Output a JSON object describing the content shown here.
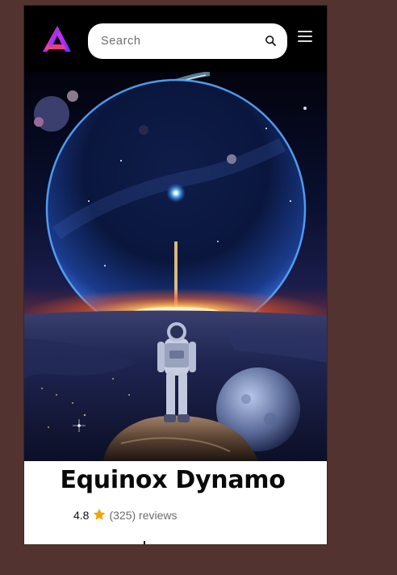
{
  "header": {
    "logo_icon": "a-letter-logo-icon",
    "search": {
      "placeholder": "Search",
      "value": "",
      "icon": "search-icon"
    },
    "menu_icon": "hamburger-menu-icon"
  },
  "hero": {
    "image": "astronaut-on-rock-facing-planet-rise-illustration"
  },
  "product": {
    "title": "Equinox Dynamo",
    "rating": "4.8",
    "reviews_text": "(325) reviews",
    "star_icon": "star-icon"
  },
  "colors": {
    "page_background": "#53332f",
    "header_background": "#000000",
    "star": "#f4a300",
    "logo_gradient_start": "#ff3d6e",
    "logo_gradient_end": "#5b2bff"
  }
}
